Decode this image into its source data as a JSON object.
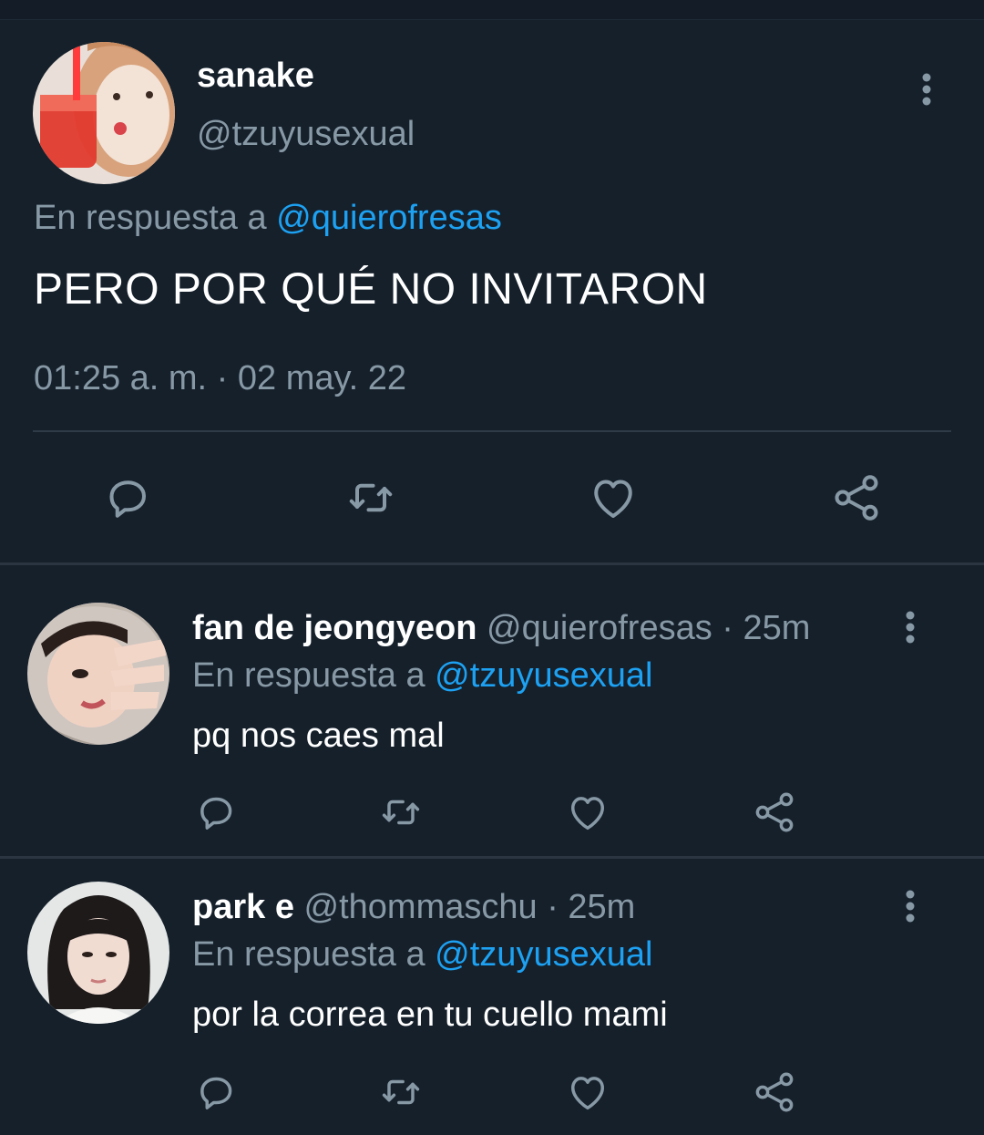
{
  "main_tweet": {
    "display_name": "sanake",
    "handle": "@tzuyusexual",
    "reply_prefix": "En respuesta a ",
    "reply_to": "@quierofresas",
    "text": "PERO POR QUÉ NO INVITARON",
    "timestamp": "01:25 a. m. · 02 may. 22"
  },
  "replies": [
    {
      "display_name": "fan de jeongyeon",
      "meta": "@quierofresas · 25m",
      "reply_prefix": "En respuesta a ",
      "reply_to": "@tzuyusexual",
      "text": "pq nos caes mal"
    },
    {
      "display_name": "park e",
      "meta": "@thommaschu · 25m",
      "reply_prefix": "En respuesta a ",
      "reply_to": "@tzuyusexual",
      "text": "por la correa en tu cuello mami"
    }
  ],
  "icons": {
    "reply": "reply-icon",
    "retweet": "retweet-icon",
    "like": "heart-icon",
    "share": "share-icon",
    "more": "more-vertical-icon"
  },
  "colors": {
    "background": "#15202b",
    "secondary_text": "#8899a6",
    "link": "#1da1f2",
    "divider": "#2f3b47"
  }
}
